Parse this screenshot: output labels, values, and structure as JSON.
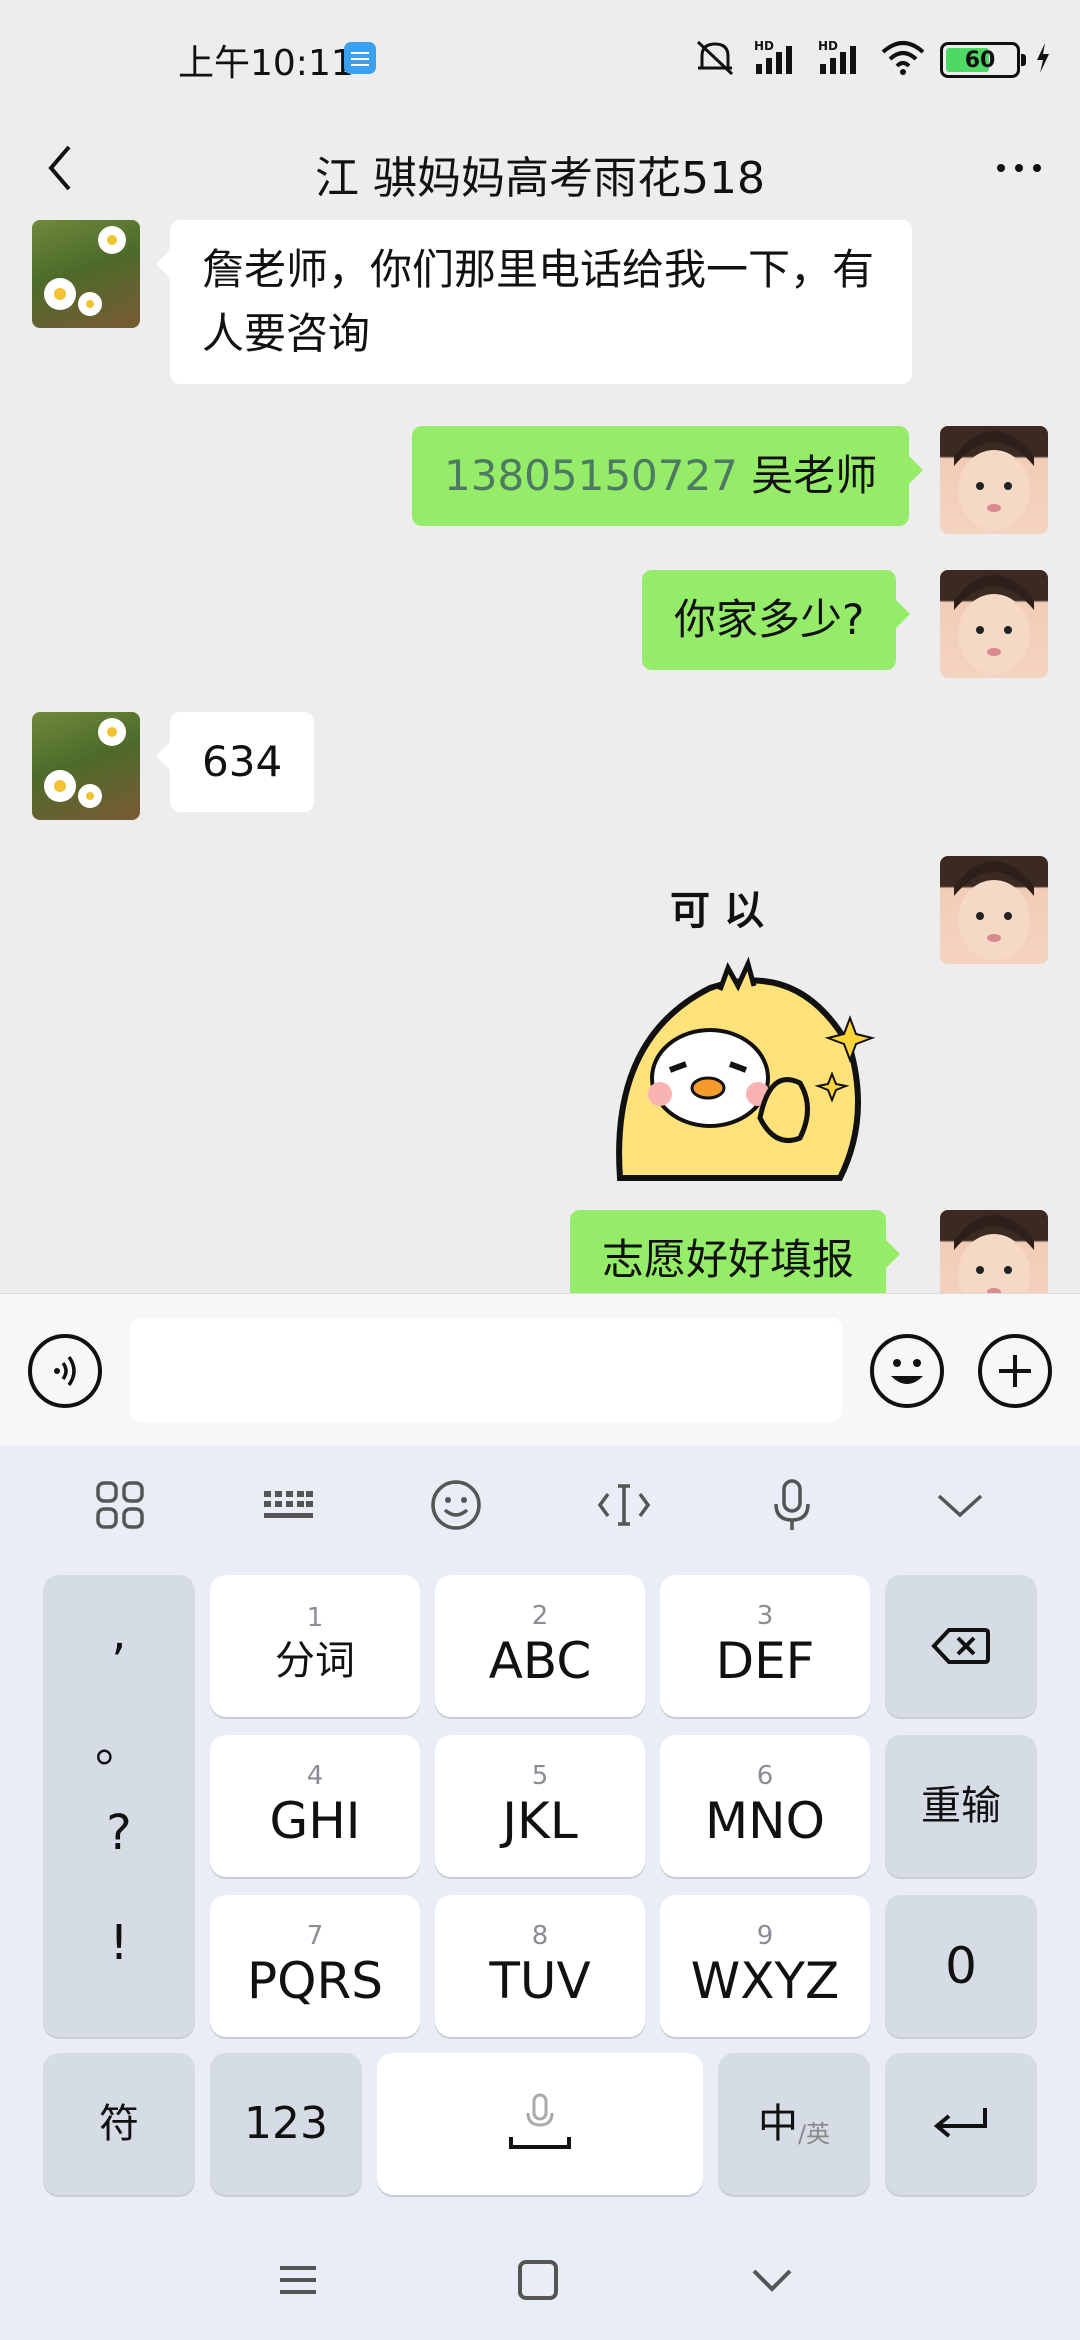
{
  "status_bar": {
    "time": "上午10:11",
    "battery": "60",
    "signal1_label": "HD",
    "signal2_label": "HD"
  },
  "header": {
    "title": "江  骐妈妈高考雨花518"
  },
  "messages": [
    {
      "side": "left",
      "text": "詹老师，你们那里电话给我一下，有人要咨询"
    },
    {
      "side": "right",
      "phone": "13805150727",
      "text": " 吴老师"
    },
    {
      "side": "right",
      "text": "你家多少?"
    },
    {
      "side": "left",
      "text": "634"
    },
    {
      "side": "right",
      "sticker_text": "可以"
    },
    {
      "side": "right",
      "text": "志愿好好填报"
    }
  ],
  "input": {
    "value": "",
    "placeholder": ""
  },
  "keyboard": {
    "punct": [
      ",",
      "。",
      "?",
      "!"
    ],
    "keys": [
      {
        "num": "1",
        "label": "分词"
      },
      {
        "num": "2",
        "label": "ABC"
      },
      {
        "num": "3",
        "label": "DEF"
      },
      {
        "num": "4",
        "label": "GHI"
      },
      {
        "num": "5",
        "label": "JKL"
      },
      {
        "num": "6",
        "label": "MNO"
      },
      {
        "num": "7",
        "label": "PQRS"
      },
      {
        "num": "8",
        "label": "TUV"
      },
      {
        "num": "9",
        "label": "WXYZ"
      }
    ],
    "reinput": "重输",
    "zero": "0",
    "symbols": "符",
    "numbers": "123",
    "lang_main": "中",
    "lang_sub": "/英"
  },
  "colors": {
    "my_bubble": "#95ec69",
    "their_bubble": "#ffffff",
    "chat_bg": "#ededed",
    "keyboard_bg": "#e8edf6"
  }
}
